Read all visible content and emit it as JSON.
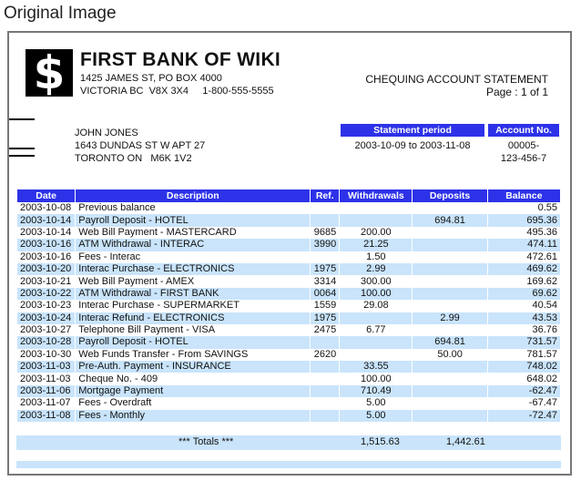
{
  "caption": "Original Image",
  "bank": {
    "logo_glyph": "$",
    "name": "FIRST BANK OF WIKI",
    "address_line1": "1425 JAMES ST, PO BOX 4000",
    "address_line2": "VICTORIA BC  V8X 3X4     1-800-555-5555"
  },
  "statement": {
    "title": "CHEQUING ACCOUNT STATEMENT",
    "page": "Page : 1 of 1"
  },
  "customer": {
    "name": "JOHN JONES",
    "address_line1": "1643 DUNDAS ST W APT 27",
    "address_line2": "TORONTO ON   M6K 1V2"
  },
  "period": {
    "header": "Statement period",
    "value": "2003-10-09 to 2003-11-08"
  },
  "account": {
    "header": "Account No.",
    "value_line1": "00005-",
    "value_line2": "123-456-7"
  },
  "table": {
    "headers": [
      "Date",
      "Description",
      "Ref.",
      "Withdrawals",
      "Deposits",
      "Balance"
    ],
    "rows": [
      {
        "date": "2003-10-08",
        "desc": "Previous balance",
        "ref": "",
        "w": "",
        "d": "",
        "bal": "0.55"
      },
      {
        "date": "2003-10-14",
        "desc": "Payroll Deposit - HOTEL",
        "ref": "",
        "w": "",
        "d": "694.81",
        "bal": "695.36"
      },
      {
        "date": "2003-10-14",
        "desc": "Web Bill Payment - MASTERCARD",
        "ref": "9685",
        "w": "200.00",
        "d": "",
        "bal": "495.36"
      },
      {
        "date": "2003-10-16",
        "desc": "ATM Withdrawal - INTERAC",
        "ref": "3990",
        "w": "21.25",
        "d": "",
        "bal": "474.11"
      },
      {
        "date": "2003-10-16",
        "desc": "Fees - Interac",
        "ref": "",
        "w": "1.50",
        "d": "",
        "bal": "472.61"
      },
      {
        "date": "2003-10-20",
        "desc": "Interac Purchase - ELECTRONICS",
        "ref": "1975",
        "w": "2.99",
        "d": "",
        "bal": "469.62"
      },
      {
        "date": "2003-10-21",
        "desc": "Web Bill Payment - AMEX",
        "ref": "3314",
        "w": "300.00",
        "d": "",
        "bal": "169.62"
      },
      {
        "date": "2003-10-22",
        "desc": "ATM Withdrawal - FIRST BANK",
        "ref": "0064",
        "w": "100.00",
        "d": "",
        "bal": "69.62"
      },
      {
        "date": "2003-10-23",
        "desc": "Interac Purchase - SUPERMARKET",
        "ref": "1559",
        "w": "29.08",
        "d": "",
        "bal": "40.54"
      },
      {
        "date": "2003-10-24",
        "desc": "Interac Refund - ELECTRONICS",
        "ref": "1975",
        "w": "",
        "d": "2.99",
        "bal": "43.53"
      },
      {
        "date": "2003-10-27",
        "desc": "Telephone Bill Payment - VISA",
        "ref": "2475",
        "w": "6.77",
        "d": "",
        "bal": "36.76"
      },
      {
        "date": "2003-10-28",
        "desc": "Payroll Deposit - HOTEL",
        "ref": "",
        "w": "",
        "d": "694.81",
        "bal": "731.57"
      },
      {
        "date": "2003-10-30",
        "desc": "Web Funds Transfer - From  SAVINGS",
        "ref": "2620",
        "w": "",
        "d": "50.00",
        "bal": "781.57"
      },
      {
        "date": "2003-11-03",
        "desc": "Pre-Auth. Payment - INSURANCE",
        "ref": "",
        "w": "33.55",
        "d": "",
        "bal": "748.02"
      },
      {
        "date": "2003-11-03",
        "desc": "Cheque No. - 409",
        "ref": "",
        "w": "100.00",
        "d": "",
        "bal": "648.02"
      },
      {
        "date": "2003-11-06",
        "desc": "Mortgage Payment",
        "ref": "",
        "w": "710.49",
        "d": "",
        "bal": "-62.47"
      },
      {
        "date": "2003-11-07",
        "desc": "Fees - Overdraft",
        "ref": "",
        "w": "5.00",
        "d": "",
        "bal": "-67.47"
      },
      {
        "date": "2003-11-08",
        "desc": "Fees - Monthly",
        "ref": "",
        "w": "5.00",
        "d": "",
        "bal": "-72.47"
      }
    ]
  },
  "totals": {
    "label": "*** Totals ***",
    "withdrawals": "1,515.63",
    "deposits": "1,442.61"
  }
}
